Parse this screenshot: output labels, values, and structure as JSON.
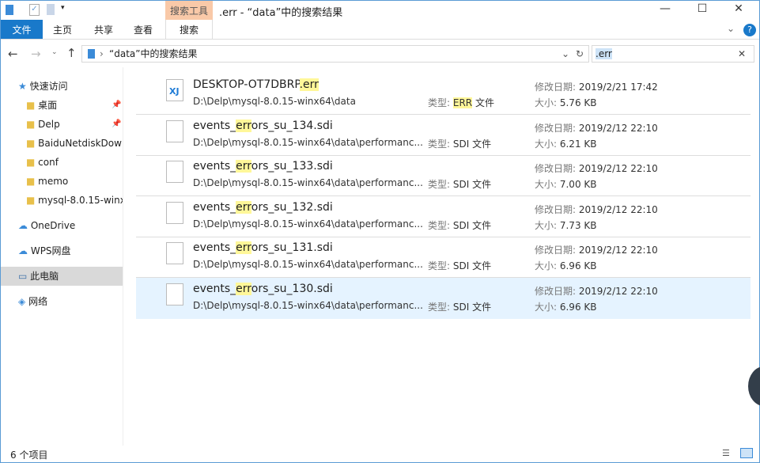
{
  "window": {
    "title": ".err - “data”中的搜索结果",
    "context_tab": "搜索工具",
    "minimize": "—",
    "maximize": "☐",
    "close": "✕"
  },
  "ribbon": {
    "tabs": [
      "文件",
      "主页",
      "共享",
      "查看",
      "搜索"
    ],
    "help": "?"
  },
  "address": {
    "path": "“data”中的搜索结果",
    "search_value": ".err"
  },
  "nav": [
    {
      "label": "快速访问",
      "icon": "star-icon"
    },
    {
      "label": "桌面",
      "icon": "folder-icon",
      "pinned": true
    },
    {
      "label": "Delp",
      "icon": "folder-icon",
      "pinned": true
    },
    {
      "label": "BaiduNetdiskDow",
      "icon": "folder-icon"
    },
    {
      "label": "conf",
      "icon": "folder-icon"
    },
    {
      "label": "memo",
      "icon": "folder-icon"
    },
    {
      "label": "mysql-8.0.15-winx",
      "icon": "folder-icon"
    },
    {
      "label": "OneDrive",
      "icon": "cloud-icon"
    },
    {
      "label": "WPS网盘",
      "icon": "cloud-icon"
    },
    {
      "label": "此电脑",
      "icon": "computer-icon"
    },
    {
      "label": "网络",
      "icon": "network-icon"
    }
  ],
  "labels": {
    "type": "类型: ",
    "date": "修改日期: ",
    "size": "大小: "
  },
  "files": [
    {
      "pre": "DESKTOP-OT7DBRP",
      "hl": ".err",
      "post": "",
      "path": "D:\\Delp\\mysql-8.0.15-winx64\\data",
      "type_hl": "ERR",
      "type": " 文件",
      "date": "2019/2/21 17:42",
      "size": "5.76 KB"
    },
    {
      "pre": "events_",
      "hl": "err",
      "post": "ors_su_134.sdi",
      "path": "D:\\Delp\\mysql-8.0.15-winx64\\data\\performanc...",
      "type_hl": "",
      "type": "SDI 文件",
      "date": "2019/2/12 22:10",
      "size": "6.21 KB"
    },
    {
      "pre": "events_",
      "hl": "err",
      "post": "ors_su_133.sdi",
      "path": "D:\\Delp\\mysql-8.0.15-winx64\\data\\performanc...",
      "type_hl": "",
      "type": "SDI 文件",
      "date": "2019/2/12 22:10",
      "size": "7.00 KB"
    },
    {
      "pre": "events_",
      "hl": "err",
      "post": "ors_su_132.sdi",
      "path": "D:\\Delp\\mysql-8.0.15-winx64\\data\\performanc...",
      "type_hl": "",
      "type": "SDI 文件",
      "date": "2019/2/12 22:10",
      "size": "7.73 KB"
    },
    {
      "pre": "events_",
      "hl": "err",
      "post": "ors_su_131.sdi",
      "path": "D:\\Delp\\mysql-8.0.15-winx64\\data\\performanc...",
      "type_hl": "",
      "type": "SDI 文件",
      "date": "2019/2/12 22:10",
      "size": "6.96 KB"
    },
    {
      "pre": "events_",
      "hl": "err",
      "post": "ors_su_130.sdi",
      "path": "D:\\Delp\\mysql-8.0.15-winx64\\data\\performanc...",
      "type_hl": "",
      "type": "SDI 文件",
      "date": "2019/2/12 22:10",
      "size": "6.96 KB"
    }
  ],
  "status": {
    "count": "6 个项目"
  }
}
